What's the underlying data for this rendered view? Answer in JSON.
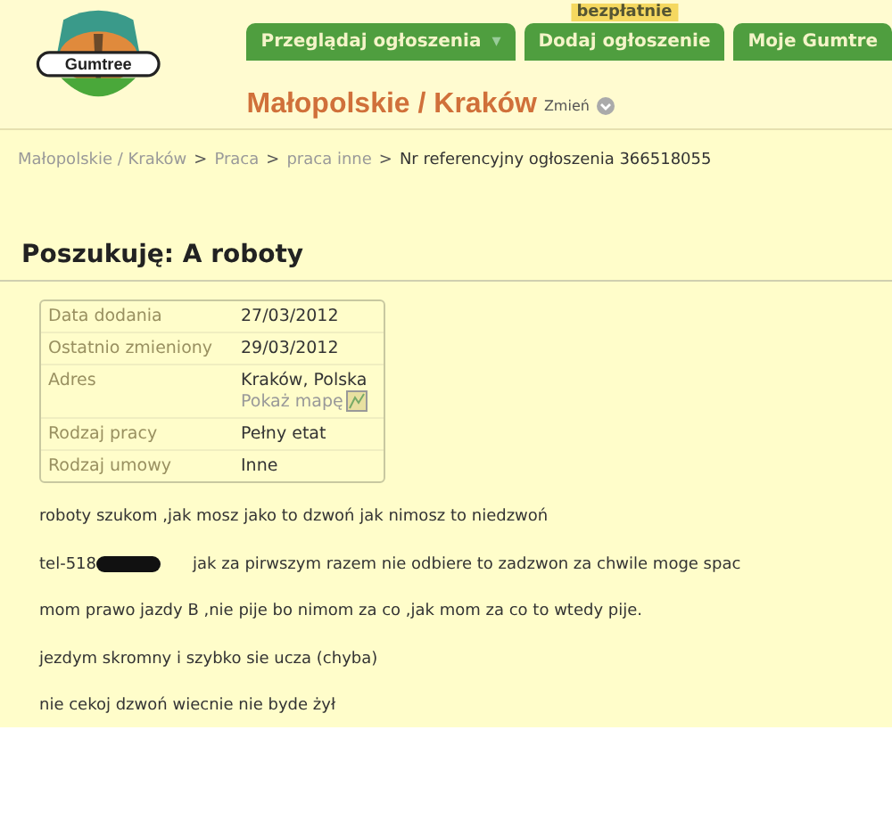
{
  "logo": {
    "text": "Gumtree"
  },
  "tabs": [
    {
      "label": "Przeglądaj ogłoszenia",
      "caret": "▾"
    },
    {
      "label": "Dodaj ogłoszenie",
      "badge": "bezpłatnie"
    },
    {
      "label": "Moje Gumtre"
    }
  ],
  "location": {
    "title": "Małopolskie / Kraków",
    "change": "Zmień"
  },
  "breadcrumb": [
    {
      "label": "Małopolskie / Kraków",
      "kind": "link"
    },
    {
      "label": "Praca",
      "kind": "link"
    },
    {
      "label": "praca inne",
      "kind": "link"
    },
    {
      "label": "Nr referencyjny ogłoszenia 366518055",
      "kind": "current"
    }
  ],
  "separator": ">",
  "ad": {
    "title": "Poszukuję: A roboty",
    "details": [
      {
        "label": "Data dodania",
        "value": "27/03/2012"
      },
      {
        "label": "Ostatnio zmieniony",
        "value": "29/03/2012"
      },
      {
        "label": "Adres",
        "value": "Kraków, Polska",
        "link": "Pokaż mapę"
      },
      {
        "label": "Rodzaj pracy",
        "value": "Pełny etat"
      },
      {
        "label": "Rodzaj umowy",
        "value": "Inne"
      }
    ],
    "description": [
      {
        "text": "roboty szukom ,jak mosz jako to dzwoń jak nimosz to niedzwoń"
      },
      {
        "prefix": "tel-518",
        "redacted": true,
        "text": "jak za pirwszym razem nie odbiere to zadzwon za chwile moge spac"
      },
      {
        "text": "mom prawo jazdy B ,nie pije bo nimom za co ,jak mom za co to wtedy pije."
      },
      {
        "text": "jezdym skromny i szybko sie ucza  (chyba)"
      },
      {
        "text": "nie cekoj dzwoń wiecnie nie byde żył"
      }
    ]
  }
}
